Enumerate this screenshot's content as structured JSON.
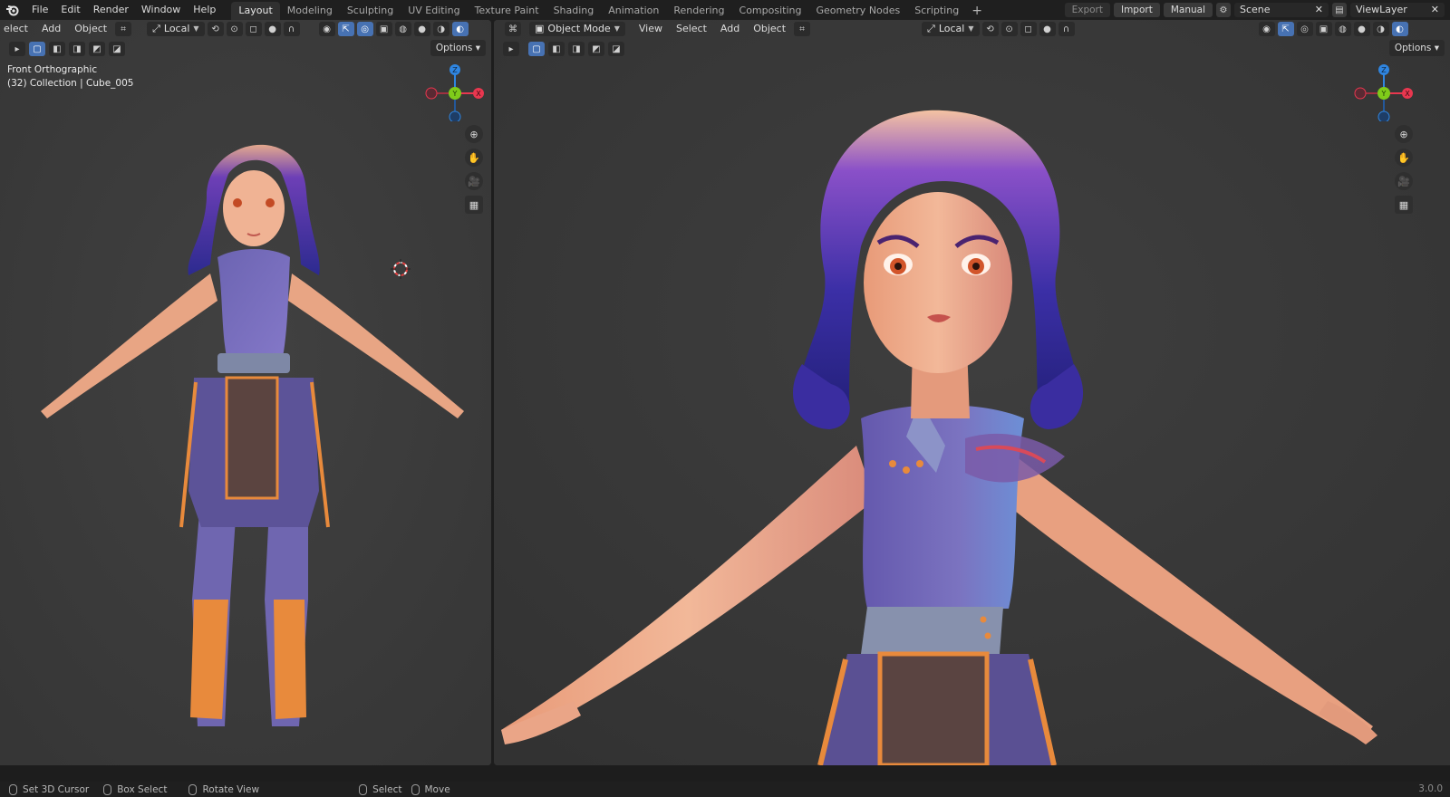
{
  "app": {
    "logo": "blender-logo-icon"
  },
  "menu": [
    "File",
    "Edit",
    "Render",
    "Window",
    "Help"
  ],
  "workspace_tabs": [
    {
      "label": "Layout",
      "active": true
    },
    {
      "label": "Modeling"
    },
    {
      "label": "Sculpting"
    },
    {
      "label": "UV Editing"
    },
    {
      "label": "Texture Paint"
    },
    {
      "label": "Shading"
    },
    {
      "label": "Animation"
    },
    {
      "label": "Rendering"
    },
    {
      "label": "Compositing"
    },
    {
      "label": "Geometry Nodes"
    },
    {
      "label": "Scripting"
    }
  ],
  "topright": {
    "export": "Export",
    "import": "Import",
    "manual": "Manual",
    "scene": "Scene",
    "view_layer": "ViewLayer"
  },
  "left_viewport": {
    "menus": [
      "elect",
      "Add",
      "Object"
    ],
    "transform_orientation": "Local",
    "options": "Options",
    "view_name": "Front Orthographic",
    "collection_info": "(32) Collection | Cube_005",
    "gizmo_axes": {
      "z": "Z",
      "y": "Y",
      "x": "X"
    }
  },
  "right_viewport": {
    "mode": "Object Mode",
    "menus": [
      "View",
      "Select",
      "Add",
      "Object"
    ],
    "transform_orientation": "Local",
    "options": "Options",
    "gizmo_axes": {
      "z": "Z",
      "y": "Y",
      "x": "X"
    }
  },
  "statusbar": {
    "items": [
      "Set 3D Cursor",
      "Box Select",
      "Rotate View",
      "Select",
      "Move"
    ],
    "version": "3.0.0"
  },
  "colors": {
    "accent_blue": "#4772b3",
    "axis_x": "#e8374f",
    "axis_y": "#7fcb1a",
    "axis_z": "#2f85e0",
    "viewport_bg": "#3d3d3d"
  }
}
